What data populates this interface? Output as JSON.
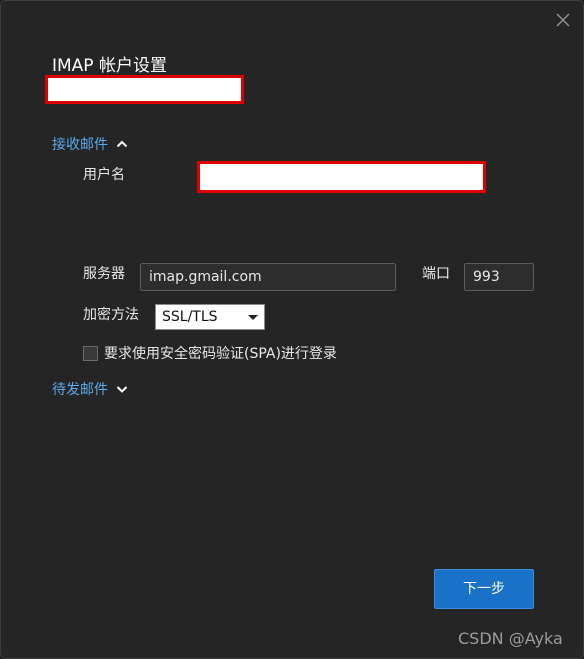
{
  "dialog": {
    "title": "IMAP 帐户设置",
    "close_icon": "close-icon"
  },
  "incoming": {
    "label": "接收邮件",
    "chevron": "chevron-up-icon",
    "username_label": "用户名",
    "server_label": "服务器",
    "server_value": "imap.gmail.com",
    "port_label": "端口",
    "port_value": "993",
    "encryption_label": "加密方法",
    "encryption_value": "SSL/TLS",
    "spa_label": "要求使用安全密码验证(SPA)进行登录"
  },
  "outgoing": {
    "label": "待发邮件",
    "chevron": "chevron-down-icon"
  },
  "footer": {
    "next_label": "下一步"
  },
  "watermark": "CSDN @Ayka",
  "colors": {
    "background": "#252526",
    "link": "#5aa9ec",
    "primary_button": "#1a72c8",
    "redaction_border": "#e00000"
  }
}
